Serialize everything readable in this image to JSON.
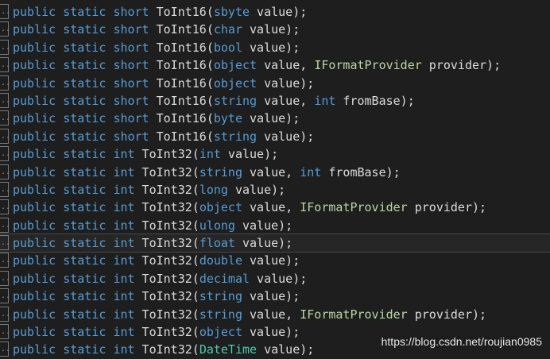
{
  "colors": {
    "background": "#1e1e1e",
    "keyword": "#569cd6",
    "identifier": "#dcdcdc",
    "interface": "#b8d7a3"
  },
  "gutter_marker": "..",
  "lines": [
    {
      "tokens": [
        {
          "t": "public",
          "c": "kw"
        },
        {
          "t": " "
        },
        {
          "t": "static",
          "c": "kw"
        },
        {
          "t": " "
        },
        {
          "t": "short",
          "c": "kw"
        },
        {
          "t": " ToInt16("
        },
        {
          "t": "sbyte",
          "c": "kw"
        },
        {
          "t": " value);"
        }
      ]
    },
    {
      "tokens": [
        {
          "t": "public",
          "c": "kw"
        },
        {
          "t": " "
        },
        {
          "t": "static",
          "c": "kw"
        },
        {
          "t": " "
        },
        {
          "t": "short",
          "c": "kw"
        },
        {
          "t": " ToInt16("
        },
        {
          "t": "char",
          "c": "kw"
        },
        {
          "t": " value);"
        }
      ]
    },
    {
      "tokens": [
        {
          "t": "public",
          "c": "kw"
        },
        {
          "t": " "
        },
        {
          "t": "static",
          "c": "kw"
        },
        {
          "t": " "
        },
        {
          "t": "short",
          "c": "kw"
        },
        {
          "t": " ToInt16("
        },
        {
          "t": "bool",
          "c": "kw"
        },
        {
          "t": " value);"
        }
      ]
    },
    {
      "tokens": [
        {
          "t": "public",
          "c": "kw"
        },
        {
          "t": " "
        },
        {
          "t": "static",
          "c": "kw"
        },
        {
          "t": " "
        },
        {
          "t": "short",
          "c": "kw"
        },
        {
          "t": " ToInt16("
        },
        {
          "t": "object",
          "c": "kw"
        },
        {
          "t": " value, "
        },
        {
          "t": "IFormatProvider",
          "c": "iface"
        },
        {
          "t": " provider);"
        }
      ]
    },
    {
      "tokens": [
        {
          "t": "public",
          "c": "kw"
        },
        {
          "t": " "
        },
        {
          "t": "static",
          "c": "kw"
        },
        {
          "t": " "
        },
        {
          "t": "short",
          "c": "kw"
        },
        {
          "t": " ToInt16("
        },
        {
          "t": "object",
          "c": "kw"
        },
        {
          "t": " value);"
        }
      ]
    },
    {
      "tokens": [
        {
          "t": "public",
          "c": "kw"
        },
        {
          "t": " "
        },
        {
          "t": "static",
          "c": "kw"
        },
        {
          "t": " "
        },
        {
          "t": "short",
          "c": "kw"
        },
        {
          "t": " ToInt16("
        },
        {
          "t": "string",
          "c": "kw"
        },
        {
          "t": " value, "
        },
        {
          "t": "int",
          "c": "kw"
        },
        {
          "t": " fromBase);"
        }
      ]
    },
    {
      "tokens": [
        {
          "t": "public",
          "c": "kw"
        },
        {
          "t": " "
        },
        {
          "t": "static",
          "c": "kw"
        },
        {
          "t": " "
        },
        {
          "t": "short",
          "c": "kw"
        },
        {
          "t": " ToInt16("
        },
        {
          "t": "byte",
          "c": "kw"
        },
        {
          "t": " value);"
        }
      ]
    },
    {
      "tokens": [
        {
          "t": "public",
          "c": "kw"
        },
        {
          "t": " "
        },
        {
          "t": "static",
          "c": "kw"
        },
        {
          "t": " "
        },
        {
          "t": "short",
          "c": "kw"
        },
        {
          "t": " ToInt16("
        },
        {
          "t": "string",
          "c": "kw"
        },
        {
          "t": " value);"
        }
      ]
    },
    {
      "tokens": [
        {
          "t": "public",
          "c": "kw"
        },
        {
          "t": " "
        },
        {
          "t": "static",
          "c": "kw"
        },
        {
          "t": " "
        },
        {
          "t": "int",
          "c": "kw"
        },
        {
          "t": " ToInt32("
        },
        {
          "t": "int",
          "c": "kw"
        },
        {
          "t": " value);"
        }
      ]
    },
    {
      "tokens": [
        {
          "t": "public",
          "c": "kw"
        },
        {
          "t": " "
        },
        {
          "t": "static",
          "c": "kw"
        },
        {
          "t": " "
        },
        {
          "t": "int",
          "c": "kw"
        },
        {
          "t": " ToInt32("
        },
        {
          "t": "string",
          "c": "kw"
        },
        {
          "t": " value, "
        },
        {
          "t": "int",
          "c": "kw"
        },
        {
          "t": " fromBase);"
        }
      ]
    },
    {
      "tokens": [
        {
          "t": "public",
          "c": "kw"
        },
        {
          "t": " "
        },
        {
          "t": "static",
          "c": "kw"
        },
        {
          "t": " "
        },
        {
          "t": "int",
          "c": "kw"
        },
        {
          "t": " ToInt32("
        },
        {
          "t": "long",
          "c": "kw"
        },
        {
          "t": " value);"
        }
      ]
    },
    {
      "tokens": [
        {
          "t": "public",
          "c": "kw"
        },
        {
          "t": " "
        },
        {
          "t": "static",
          "c": "kw"
        },
        {
          "t": " "
        },
        {
          "t": "int",
          "c": "kw"
        },
        {
          "t": " ToInt32("
        },
        {
          "t": "object",
          "c": "kw"
        },
        {
          "t": " value, "
        },
        {
          "t": "IFormatProvider",
          "c": "iface"
        },
        {
          "t": " provider);"
        }
      ]
    },
    {
      "tokens": [
        {
          "t": "public",
          "c": "kw"
        },
        {
          "t": " "
        },
        {
          "t": "static",
          "c": "kw"
        },
        {
          "t": " "
        },
        {
          "t": "int",
          "c": "kw"
        },
        {
          "t": " ToInt32("
        },
        {
          "t": "ulong",
          "c": "kw"
        },
        {
          "t": " value);"
        }
      ]
    },
    {
      "highlight": true,
      "tokens": [
        {
          "t": "public",
          "c": "kw"
        },
        {
          "t": " "
        },
        {
          "t": "static",
          "c": "kw"
        },
        {
          "t": " "
        },
        {
          "t": "int",
          "c": "kw"
        },
        {
          "t": " ToInt32("
        },
        {
          "t": "float",
          "c": "kw"
        },
        {
          "t": " value);"
        }
      ]
    },
    {
      "tokens": [
        {
          "t": "public",
          "c": "kw"
        },
        {
          "t": " "
        },
        {
          "t": "static",
          "c": "kw"
        },
        {
          "t": " "
        },
        {
          "t": "int",
          "c": "kw"
        },
        {
          "t": " ToInt32("
        },
        {
          "t": "double",
          "c": "kw"
        },
        {
          "t": " value);"
        }
      ]
    },
    {
      "tokens": [
        {
          "t": "public",
          "c": "kw"
        },
        {
          "t": " "
        },
        {
          "t": "static",
          "c": "kw"
        },
        {
          "t": " "
        },
        {
          "t": "int",
          "c": "kw"
        },
        {
          "t": " ToInt32("
        },
        {
          "t": "decimal",
          "c": "kw"
        },
        {
          "t": " value);"
        }
      ]
    },
    {
      "tokens": [
        {
          "t": "public",
          "c": "kw"
        },
        {
          "t": " "
        },
        {
          "t": "static",
          "c": "kw"
        },
        {
          "t": " "
        },
        {
          "t": "int",
          "c": "kw"
        },
        {
          "t": " ToInt32("
        },
        {
          "t": "string",
          "c": "kw"
        },
        {
          "t": " value);"
        }
      ]
    },
    {
      "tokens": [
        {
          "t": "public",
          "c": "kw"
        },
        {
          "t": " "
        },
        {
          "t": "static",
          "c": "kw"
        },
        {
          "t": " "
        },
        {
          "t": "int",
          "c": "kw"
        },
        {
          "t": " ToInt32("
        },
        {
          "t": "string",
          "c": "kw"
        },
        {
          "t": " value, "
        },
        {
          "t": "IFormatProvider",
          "c": "iface"
        },
        {
          "t": " provider);"
        }
      ]
    },
    {
      "tokens": [
        {
          "t": "public",
          "c": "kw"
        },
        {
          "t": " "
        },
        {
          "t": "static",
          "c": "kw"
        },
        {
          "t": " "
        },
        {
          "t": "int",
          "c": "kw"
        },
        {
          "t": " ToInt32("
        },
        {
          "t": "object",
          "c": "kw"
        },
        {
          "t": " value);"
        }
      ]
    },
    {
      "tokens": [
        {
          "t": "public",
          "c": "kw"
        },
        {
          "t": " "
        },
        {
          "t": "static",
          "c": "kw"
        },
        {
          "t": " "
        },
        {
          "t": "int",
          "c": "kw"
        },
        {
          "t": " ToInt32("
        },
        {
          "t": "DateTime",
          "c": "tp"
        },
        {
          "t": " value);"
        }
      ]
    }
  ],
  "watermark": "https://blog.csdn.net/roujian0985"
}
